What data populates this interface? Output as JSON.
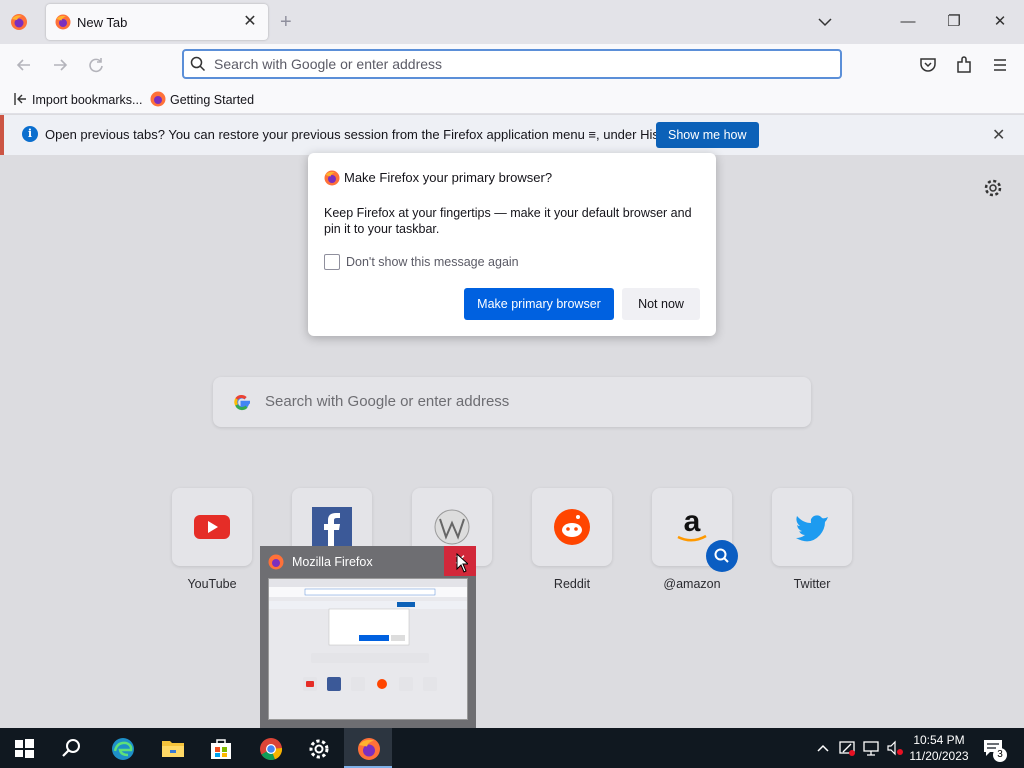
{
  "browser": {
    "tab": {
      "title": "New Tab",
      "close": "✕"
    },
    "new_tab": "+",
    "window_controls": {
      "minimize": "—",
      "restore": "❐",
      "close": "✕"
    },
    "address_bar": {
      "placeholder": "Search with Google or enter address",
      "value": ""
    },
    "toolbar_icons": [
      "back-icon",
      "forward-icon",
      "reload-icon",
      "pocket-icon",
      "extensions-icon",
      "menu-icon"
    ]
  },
  "bookmarks": [
    {
      "label": "Import bookmarks...",
      "icon": "import-icon"
    },
    {
      "label": "Getting Started",
      "icon": "firefox-icon"
    }
  ],
  "notification": {
    "message": "Open previous tabs? You can restore your previous session from the Firefox application menu ≡, under History.",
    "button": "Show me how",
    "close": "✕"
  },
  "new_tab_page": {
    "search_placeholder": "Search with Google or enter address",
    "top_sites": [
      {
        "label": "YouTube",
        "icon": "youtube-icon"
      },
      {
        "label": "",
        "icon": "facebook-icon"
      },
      {
        "label": "",
        "icon": "wikipedia-icon"
      },
      {
        "label": "Reddit",
        "icon": "reddit-icon"
      },
      {
        "label": "@amazon",
        "icon": "amazon-icon"
      },
      {
        "label": "Twitter",
        "icon": "twitter-icon"
      }
    ]
  },
  "dialog": {
    "title": "Make Firefox your primary browser?",
    "body": "Keep Firefox at your fingertips — make it your default browser and pin it to your taskbar.",
    "checkbox_label": "Don't show this message again",
    "checkbox_checked": false,
    "primary_button": "Make primary browser",
    "secondary_button": "Not now"
  },
  "thumbnail_preview": {
    "title": "Mozilla Firefox",
    "close": "✕"
  },
  "taskbar": {
    "apps": [
      "windows-start-icon",
      "search-icon",
      "edge-icon",
      "file-explorer-icon",
      "microsoft-store-icon",
      "chrome-icon",
      "settings-icon",
      "firefox-icon"
    ],
    "time": "10:54 PM",
    "date": "11/20/2023",
    "notification_count": "3"
  },
  "colors": {
    "accent": "#0061e0",
    "notification_button": "#0c61b8",
    "close_red": "#d2283a",
    "taskbar": "#101820"
  }
}
